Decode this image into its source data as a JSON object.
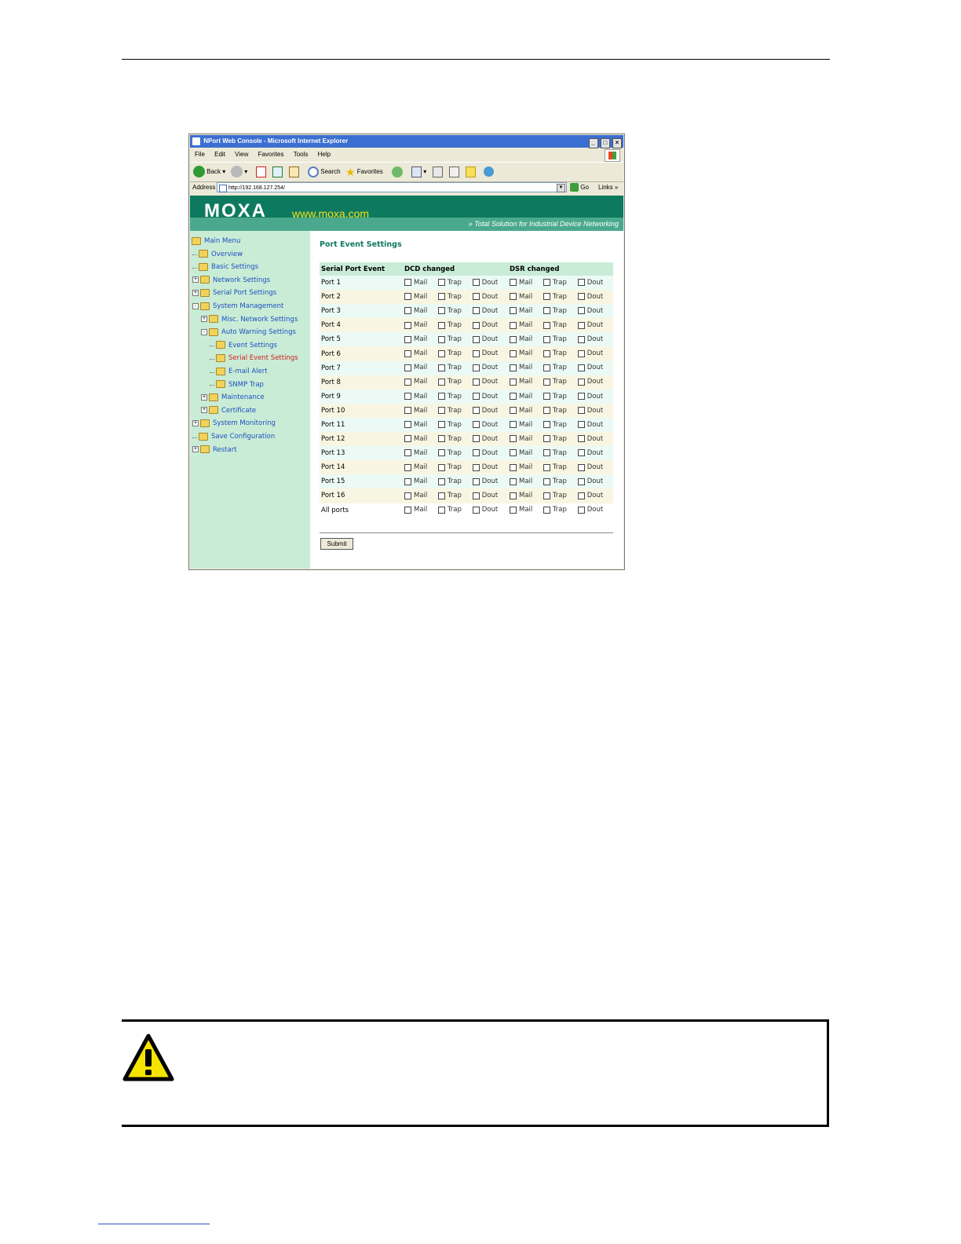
{
  "window": {
    "title": "NPort Web Console - Microsoft Internet Explorer",
    "controls": [
      "_",
      "□",
      "×"
    ]
  },
  "menu": [
    "File",
    "Edit",
    "View",
    "Favorites",
    "Tools",
    "Help"
  ],
  "toolbar": {
    "back": "Back",
    "search": "Search",
    "favorites": "Favorites"
  },
  "address": {
    "label": "Address",
    "url": "http://192.168.127.254/",
    "go": "Go",
    "links": "Links",
    "links_more": "»"
  },
  "banner": {
    "logo": "MOXA",
    "site": "www.moxa.com",
    "tagline": "»  Total Solution for Industrial Device Networking"
  },
  "nav": [
    {
      "label": "Main Menu",
      "level": 0,
      "expander": "",
      "active": false
    },
    {
      "label": "Overview",
      "level": 1,
      "expander": "",
      "active": false
    },
    {
      "label": "Basic Settings",
      "level": 1,
      "expander": "",
      "active": false
    },
    {
      "label": "Network Settings",
      "level": 1,
      "expander": "+",
      "active": false
    },
    {
      "label": "Serial Port Settings",
      "level": 1,
      "expander": "+",
      "active": false
    },
    {
      "label": "System Management",
      "level": 1,
      "expander": "-",
      "active": false
    },
    {
      "label": "Misc. Network Settings",
      "level": 2,
      "expander": "+",
      "active": false
    },
    {
      "label": "Auto Warning Settings",
      "level": 2,
      "expander": "-",
      "active": false
    },
    {
      "label": "Event Settings",
      "level": 3,
      "expander": "",
      "active": false
    },
    {
      "label": "Serial Event Settings",
      "level": 3,
      "expander": "",
      "active": true
    },
    {
      "label": "E-mail Alert",
      "level": 3,
      "expander": "",
      "active": false
    },
    {
      "label": "SNMP Trap",
      "level": 3,
      "expander": "",
      "active": false
    },
    {
      "label": "Maintenance",
      "level": 2,
      "expander": "+",
      "active": false
    },
    {
      "label": "Certificate",
      "level": 2,
      "expander": "+",
      "active": false
    },
    {
      "label": "System Monitoring",
      "level": 1,
      "expander": "+",
      "active": false
    },
    {
      "label": "Save Configuration",
      "level": 1,
      "expander": "",
      "active": false
    },
    {
      "label": "Restart",
      "level": 1,
      "expander": "+",
      "active": false
    }
  ],
  "content": {
    "title": "Port Event Settings",
    "headers": [
      "Serial Port Event",
      "DCD changed",
      "DSR changed"
    ],
    "options": [
      "Mail",
      "Trap",
      "Dout"
    ],
    "rows": [
      "Port 1",
      "Port 2",
      "Port 3",
      "Port 4",
      "Port 5",
      "Port 6",
      "Port 7",
      "Port 8",
      "Port 9",
      "Port 10",
      "Port 11",
      "Port 12",
      "Port 13",
      "Port 14",
      "Port 15",
      "Port 16",
      "All ports"
    ],
    "submit": "Submit"
  },
  "colors": {
    "banner": "#0d7a5f",
    "banner_tagline_stripe": "#4aa98c",
    "site_text": "#f4e21b",
    "sidebar": "#c9ecd6",
    "nav_link": "#1c4fc0",
    "nav_active": "#d02020",
    "title_bar": "#3b6fd1",
    "warning": "#f5e400"
  }
}
